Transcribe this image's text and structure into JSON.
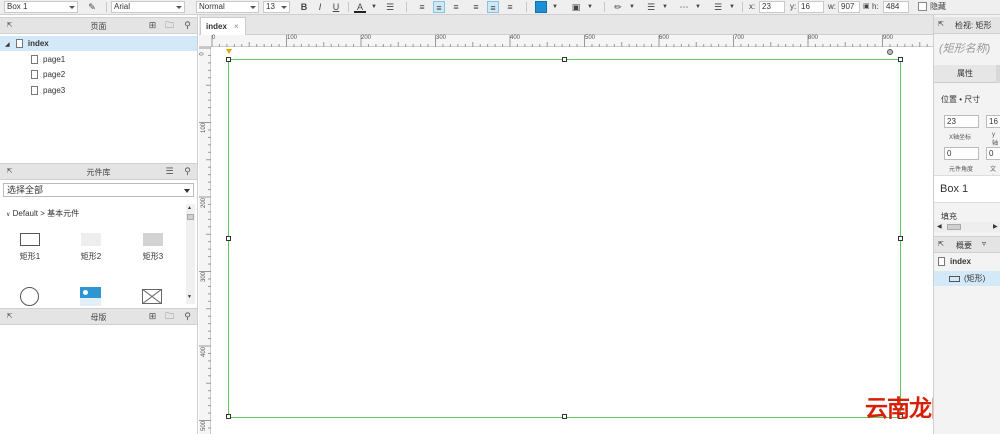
{
  "toolbar": {
    "element_name": "Box 1",
    "font_family": "Arial",
    "font_style": "Normal",
    "font_size": "13",
    "bold": "B",
    "italic": "I",
    "underline": "U",
    "text_color_letter": "A",
    "x_label": "x:",
    "x_value": "23",
    "y_label": "y:",
    "y_value": "16",
    "w_label": "w:",
    "w_value": "907",
    "h_label": "h:",
    "h_value": "484",
    "hidden_label": "隐藏"
  },
  "pages_panel": {
    "title": "页面",
    "root": "index",
    "pages": [
      "page1",
      "page2",
      "page3"
    ]
  },
  "library_panel": {
    "title": "元件库",
    "select_value": "选择全部",
    "category": "Default > 基本元件",
    "items": [
      "矩形1",
      "矩形2",
      "矩形3"
    ]
  },
  "masters_panel": {
    "title": "母版"
  },
  "canvas": {
    "tab_label": "index",
    "tab_close": "×",
    "ruler_top_labels": [
      "0",
      "100",
      "200",
      "300",
      "400",
      "500",
      "600",
      "700",
      "800",
      "900"
    ],
    "ruler_left_labels": [
      "0",
      "100",
      "200",
      "300",
      "400",
      "500"
    ]
  },
  "inspector": {
    "title": "检视: 矩形",
    "shape_name_placeholder": "(矩形名称)",
    "tab_properties": "属性",
    "section_position": "位置 • 尺寸",
    "x_value": "23",
    "y_value": "16",
    "x_caption": "X轴坐标",
    "y_caption": "y轴",
    "angle_value": "0",
    "text_angle_value": "0",
    "angle_caption": "元件角度",
    "text_angle_caption": "文本",
    "widget_name": "Box 1",
    "fill_label": "填充"
  },
  "outline": {
    "title": "概要",
    "root": "index",
    "item": "(矩形)"
  },
  "watermark": "云南龙网",
  "colors": {
    "selection": "#5ccb5c",
    "accent": "#0e7cc0",
    "panel_bg": "#f3f3f3",
    "watermark_red": "#d81e06"
  }
}
